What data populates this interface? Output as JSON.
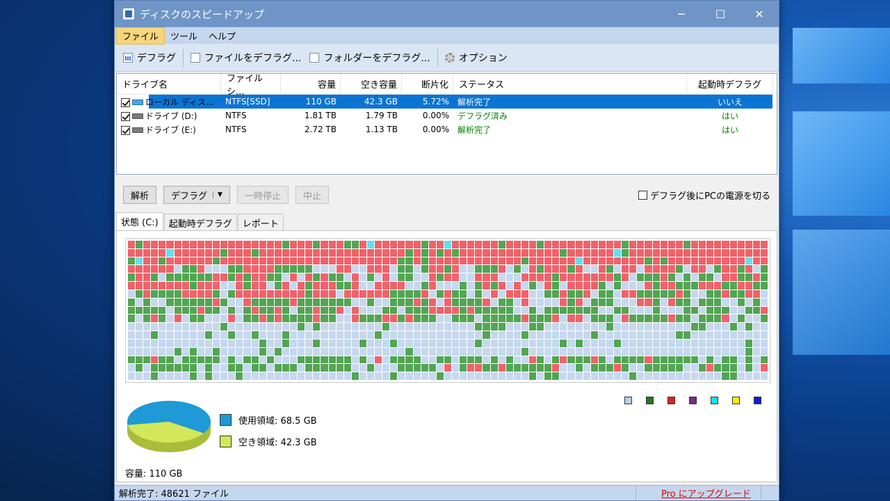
{
  "window": {
    "title": "ディスクのスピードアップ",
    "controls": {
      "minimize": "─",
      "maximize": "☐",
      "close": "✕"
    }
  },
  "menu": [
    "ファイル",
    "ツール",
    "ヘルプ"
  ],
  "toolbar": {
    "defrag": "デフラグ",
    "defrag_file": "ファイルをデフラグ...",
    "defrag_folder": "フォルダーをデフラグ...",
    "options": "オプション"
  },
  "drive_list": {
    "columns": [
      "ドライブ名",
      "ファイルシ...",
      "容量",
      "空き容量",
      "断片化",
      "ステータス",
      "起動時デフラグ"
    ],
    "rows": [
      {
        "checked": true,
        "name": "ローカル ディス...",
        "fs": "NTFS[SSD]",
        "capacity": "110 GB",
        "free": "42.3 GB",
        "frag": "5.72%",
        "status": "解析完了",
        "boot": "いいえ",
        "selected": true,
        "system": true
      },
      {
        "checked": true,
        "name": "ドライブ (D:)",
        "fs": "NTFS",
        "capacity": "1.81 TB",
        "free": "1.79 TB",
        "frag": "0.00%",
        "status": "デフラグ済み",
        "boot": "はい",
        "selected": false,
        "system": false
      },
      {
        "checked": true,
        "name": "ドライブ (E:)",
        "fs": "NTFS",
        "capacity": "2.72 TB",
        "free": "1.13 TB",
        "frag": "0.00%",
        "status": "解析完了",
        "boot": "はい",
        "selected": false,
        "system": false
      }
    ]
  },
  "actions": {
    "analyze": "解析",
    "defrag": "デフラグ",
    "pause": "一時停止",
    "stop": "中止",
    "power_off": "デフラグ後にPCの電源を切る"
  },
  "tabs": [
    "状態 (C:)",
    "起動時デフラグ",
    "レポート"
  ],
  "legend_colors": [
    "#b8cde8",
    "#1f7a1f",
    "#e02020",
    "#7a2a8a",
    "#00e5ff",
    "#ffee00",
    "#1020d0"
  ],
  "cluster_colors": {
    "free": "#c6d8ee",
    "used": "#52a552",
    "frag": "#f0626a",
    "cyan": "#5fe0f0"
  },
  "disk_usage": {
    "used_label": "使用領域: 68.5 GB",
    "free_label": "空き領域: 42.3 GB",
    "used_color": "#1f9ad6",
    "free_color": "#d2e85a",
    "used_gb": 68.5,
    "free_gb": 42.3,
    "capacity_label": "容量: 110 GB"
  },
  "status": {
    "text": "解析完了: 48621 ファイル",
    "upgrade": "Pro にアップグレード"
  }
}
